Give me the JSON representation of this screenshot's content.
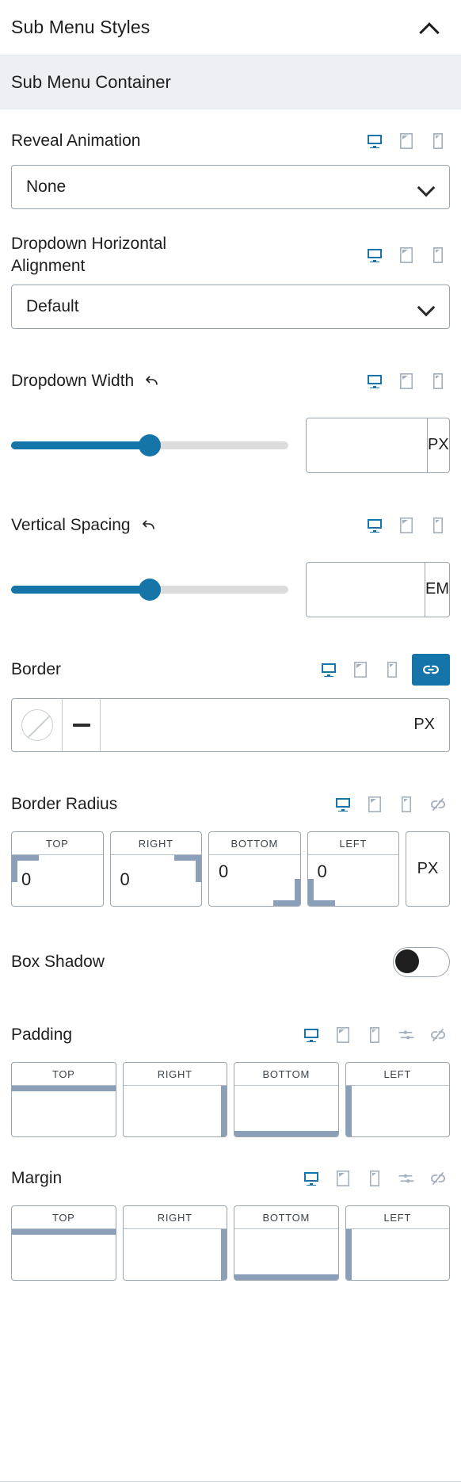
{
  "section": {
    "title": "Sub Menu Styles",
    "collapse_icon": "chevron-up-icon"
  },
  "subsection": {
    "title": "Sub Menu Container"
  },
  "devices": {
    "desktop": "desktop-icon",
    "tablet": "tablet-icon",
    "mobile": "mobile-icon",
    "active": "desktop"
  },
  "controls": {
    "reveal_animation": {
      "label": "Reveal Animation",
      "value": "None",
      "options": [
        "None"
      ]
    },
    "dropdown_horizontal_alignment": {
      "label_line1": "Dropdown Horizontal",
      "label_line2": "Alignment",
      "value": "Default",
      "options": [
        "Default"
      ]
    },
    "dropdown_width": {
      "label": "Dropdown Width",
      "value": "",
      "unit": "PX",
      "slider_percent": 50
    },
    "vertical_spacing": {
      "label": "Vertical Spacing",
      "value": "",
      "unit": "EM",
      "slider_percent": 50
    },
    "border": {
      "label": "Border",
      "value": "",
      "unit": "PX",
      "color_swatch": "no-color",
      "style_indicator": "dash",
      "linked": true
    },
    "border_radius": {
      "label": "Border Radius",
      "unit": "PX",
      "linked": false,
      "fields": [
        {
          "label": "TOP",
          "value": "0"
        },
        {
          "label": "RIGHT",
          "value": "0"
        },
        {
          "label": "BOTTOM",
          "value": "0"
        },
        {
          "label": "LEFT",
          "value": "0"
        }
      ]
    },
    "box_shadow": {
      "label": "Box Shadow",
      "enabled": false
    },
    "padding": {
      "label": "Padding",
      "linked": false,
      "fields": [
        {
          "label": "TOP",
          "value": ""
        },
        {
          "label": "RIGHT",
          "value": ""
        },
        {
          "label": "BOTTOM",
          "value": ""
        },
        {
          "label": "LEFT",
          "value": ""
        }
      ]
    },
    "margin": {
      "label": "Margin",
      "linked": false,
      "fields": [
        {
          "label": "TOP",
          "value": ""
        },
        {
          "label": "RIGHT",
          "value": ""
        },
        {
          "label": "BOTTOM",
          "value": ""
        },
        {
          "label": "LEFT",
          "value": ""
        }
      ]
    }
  },
  "colors": {
    "accent": "#1575a8",
    "device_inactive": "#a4b0bd",
    "banner_bg": "#eceff3",
    "text": "#1e1e1e",
    "border": "#9aa4ad",
    "mark": "#8ba0b8"
  }
}
